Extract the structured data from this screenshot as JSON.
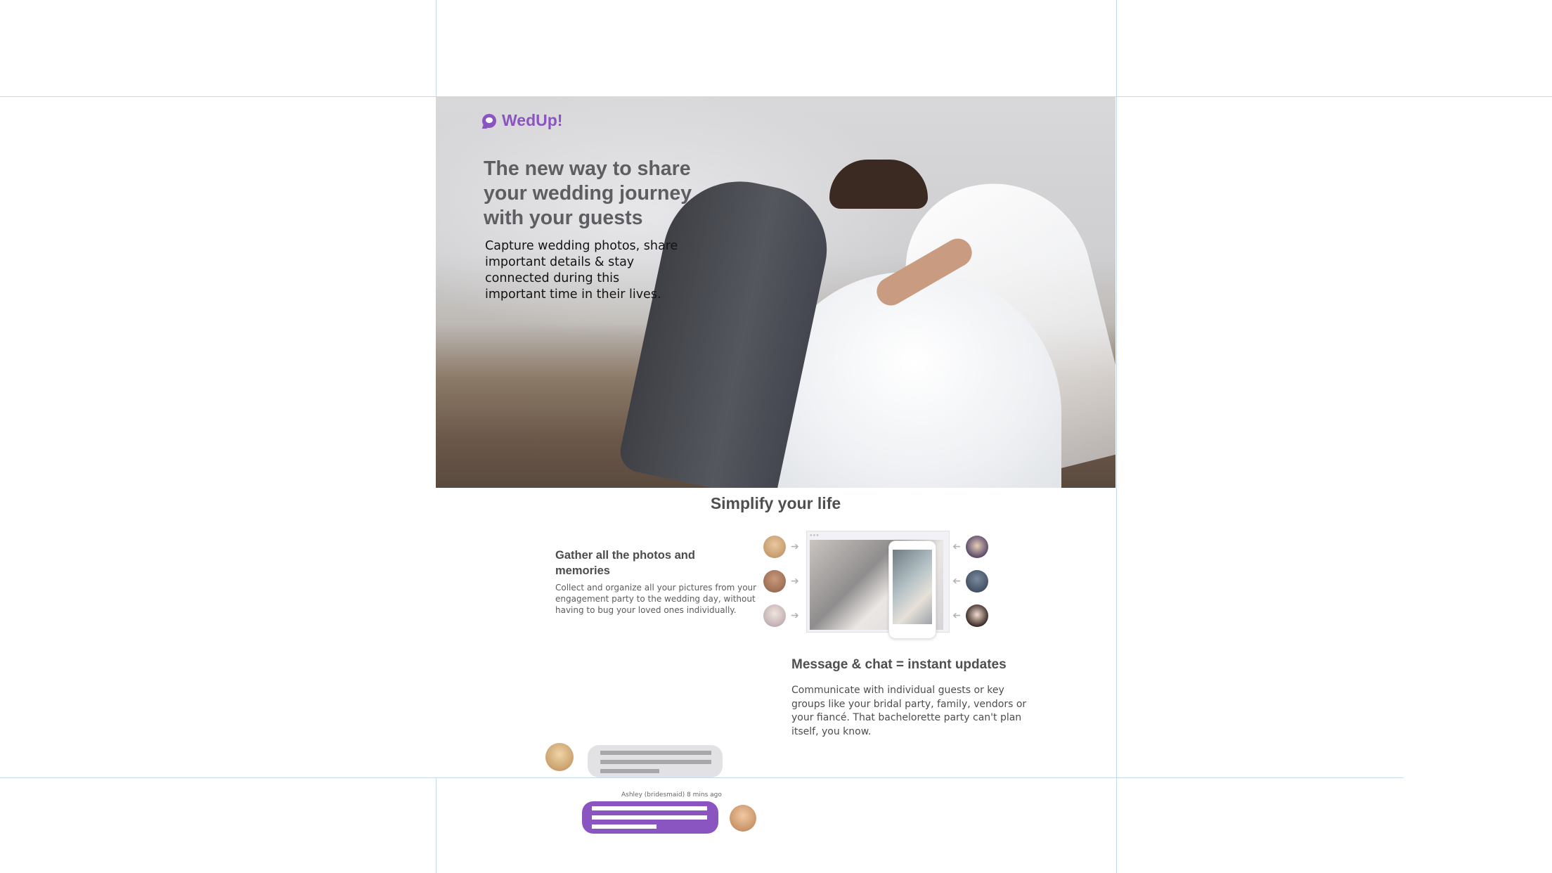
{
  "brand": {
    "name": "WedUp!",
    "icon": "chat-bubble-icon",
    "accent": "#8b55c1"
  },
  "hero": {
    "headline": "The new way to share your wedding journey with your guests",
    "subcopy": "Capture wedding photos, share important details & stay connected during this important time in their lives."
  },
  "section": {
    "title": "Simplify your life"
  },
  "feature_photos": {
    "title": "Gather all the photos and memories",
    "body": "Collect and organize all your pictures from your engagement party to the wedding day, without having to bug your loved ones individually."
  },
  "feature_chat": {
    "title": "Message & chat = instant updates",
    "body": "Communicate with individual guests or key groups like your bridal party, family, vendors or your fiancé. That bachelorette party can't plan itself, you know.",
    "message_meta": "Ashley (bridesmaid) 8 mins ago"
  }
}
